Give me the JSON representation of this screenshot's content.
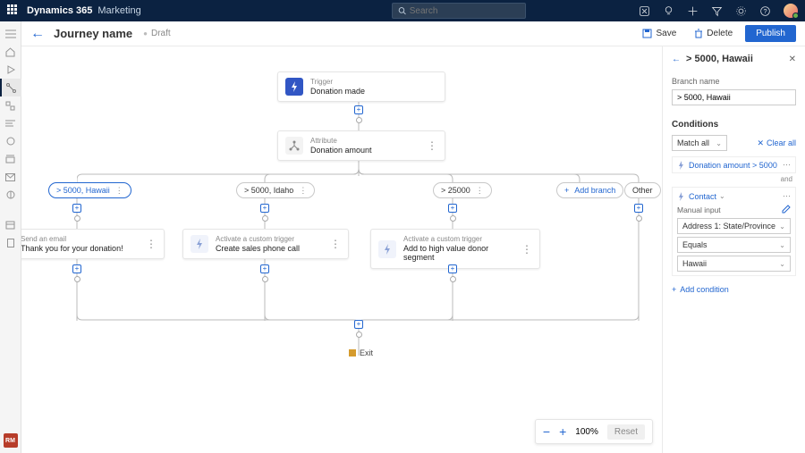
{
  "header": {
    "brand": "Dynamics 365",
    "module": "Marketing",
    "search_placeholder": "Search"
  },
  "page": {
    "title": "Journey name",
    "status": "Draft",
    "actions": {
      "save": "Save",
      "delete": "Delete",
      "publish": "Publish"
    }
  },
  "canvas": {
    "trigger": {
      "overline": "Trigger",
      "label": "Donation made"
    },
    "attribute": {
      "overline": "Attribute",
      "label": "Donation amount"
    },
    "branches": [
      {
        "label": "> 5000, Hawaii",
        "selected": true
      },
      {
        "label": "> 5000, Idaho"
      },
      {
        "label": "> 25000"
      }
    ],
    "add_branch": "Add branch",
    "other": "Other",
    "actions": [
      {
        "overline": "Send an email",
        "label": "Thank you for your donation!"
      },
      {
        "overline": "Activate a custom trigger",
        "label": "Create sales phone call"
      },
      {
        "overline": "Activate a custom trigger",
        "label": "Add to high value donor segment"
      }
    ],
    "exit": "Exit"
  },
  "zoom": {
    "level": "100%",
    "reset": "Reset"
  },
  "panel": {
    "title": "> 5000, Hawaii",
    "branch_name_label": "Branch name",
    "branch_name_value": "> 5000, Hawaii",
    "conditions_label": "Conditions",
    "match": "Match all",
    "clear_all": "Clear all",
    "condition1": "Donation amount > 5000",
    "and": "and",
    "group_entity": "Contact",
    "manual_input_label": "Manual input",
    "field": "Address 1: State/Province",
    "operator": "Equals",
    "value": "Hawaii",
    "add_condition": "Add condition"
  },
  "rail_badge": "RM"
}
